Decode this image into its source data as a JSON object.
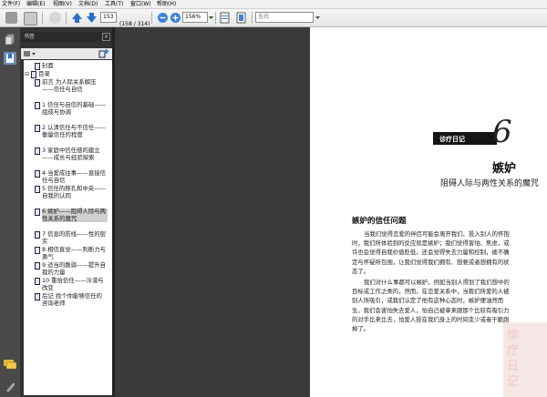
{
  "menu": [
    "文件(F)",
    "编辑(E)",
    "视图(V)",
    "文档(D)",
    "工具(T)",
    "窗口(W)",
    "帮助(H)"
  ],
  "toolbar": {
    "page_current": "153",
    "page_total": "(158 / 314)",
    "zoom": "156%",
    "search_placeholder": "查找"
  },
  "panel": {
    "title": "书签",
    "close": "×"
  },
  "bookmarks": [
    {
      "text": "封面",
      "level": 1
    },
    {
      "text": "目录",
      "level": 0
    },
    {
      "text": "前言 为人际关系解压——信任与自信",
      "level": 1
    },
    {
      "text": "1 信任与自信的基础——组成与协调",
      "level": 1
    },
    {
      "text": "2 认清信任与不信任——衡量信任的程度",
      "level": 1
    },
    {
      "text": "3 家庭中信任感的建立——成长与经验探索",
      "level": 1
    },
    {
      "text": "4 当爱成往事——直接信任与自信",
      "level": 1
    },
    {
      "text": "5 信任的移孔和中央——自我的认同",
      "level": 1
    },
    {
      "text": "6 嫉妒——阻碍人际与两性关系的魔咒",
      "level": 1
    },
    {
      "text": "7 信息的防线——性的密实",
      "level": 1
    },
    {
      "text": "8 相信直觉——判断力与勇气",
      "level": 1
    },
    {
      "text": "9 适当的脆弱——提升自我的力量",
      "level": 1
    },
    {
      "text": "10 重拾信任——冷漠与改变",
      "level": 1
    },
    {
      "text": "后记 找个你能够信任的咨询老师",
      "level": 1
    }
  ],
  "page": {
    "label": "诊疗日记",
    "number": "6",
    "title": "嫉妒",
    "subtitle": "阻碍人际与两性关系的魔咒",
    "section_heading": "嫉妒的信任问题",
    "paragraphs": [
      "当我们觉得恋爱的伴侣可能会离开我们、投入别人的怀抱时，我们所体验到的反应就是嫉妒；我们觉得害怕、焦虑，或许也会觉得自我价值贬低，还会觉得失去力量和控制，被不确定与怀疑所包围，让我们觉得我们拥有、想要或者想拥有的状态了。",
      "我们对什么事都可以嫉妒，例如当别人得到了我们想中的目标或工作之类的，然而，在恋爱关系中，当我们所爱的人被别人所吸引，或我们认定了他有这种心态时，嫉妒便油然而生，我们会害怕失去爱人，怕自己被拿来跟那个比较有吸引力的对手比来比去，怕爱人投在我们身上的时间变少或者干脆跑掉了。"
    ]
  },
  "watermark": "诊疗日记"
}
